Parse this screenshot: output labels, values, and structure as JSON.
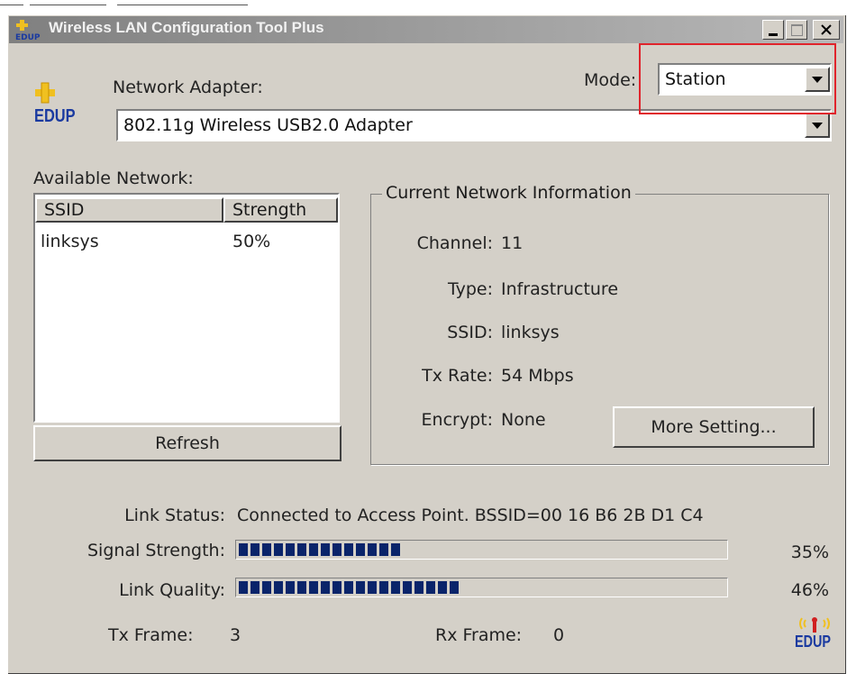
{
  "window": {
    "title": "Wireless LAN Configuration Tool Plus"
  },
  "mode": {
    "label": "Mode:",
    "value": "Station"
  },
  "adapter": {
    "label": "Network Adapter:",
    "value": "802.11g Wireless USB2.0 Adapter"
  },
  "brand": {
    "logo_text": "EDUP"
  },
  "available": {
    "label": "Available Network:",
    "columns": [
      "SSID",
      "Strength"
    ],
    "rows": [
      {
        "ssid": "linksys",
        "strength": "50%"
      }
    ],
    "refresh_label": "Refresh"
  },
  "current": {
    "legend": "Current Network Information",
    "channel_label": "Channel:",
    "channel": "11",
    "type_label": "Type:",
    "type": "Infrastructure",
    "ssid_label": "SSID:",
    "ssid": "linksys",
    "txrate_label": "Tx Rate:",
    "txrate": "54 Mbps",
    "encrypt_label": "Encrypt:",
    "encrypt": "None",
    "more_label": "More Setting..."
  },
  "status": {
    "link_label": "Link Status:",
    "link_value": "Connected to Access Point. BSSID=00 16 B6 2B D1 C4",
    "signal_label": "Signal Strength:",
    "signal_percent": "35%",
    "signal_fraction": 0.35,
    "quality_label": "Link Quality:",
    "quality_percent": "46%",
    "quality_fraction": 0.46,
    "tx_label": "Tx Frame:",
    "tx_value": "3",
    "rx_label": "Rx Frame:",
    "rx_value": "0"
  },
  "colors": {
    "bar_fill": "#0a246a",
    "highlight": "#e0242c",
    "face": "#d4d0c8"
  }
}
